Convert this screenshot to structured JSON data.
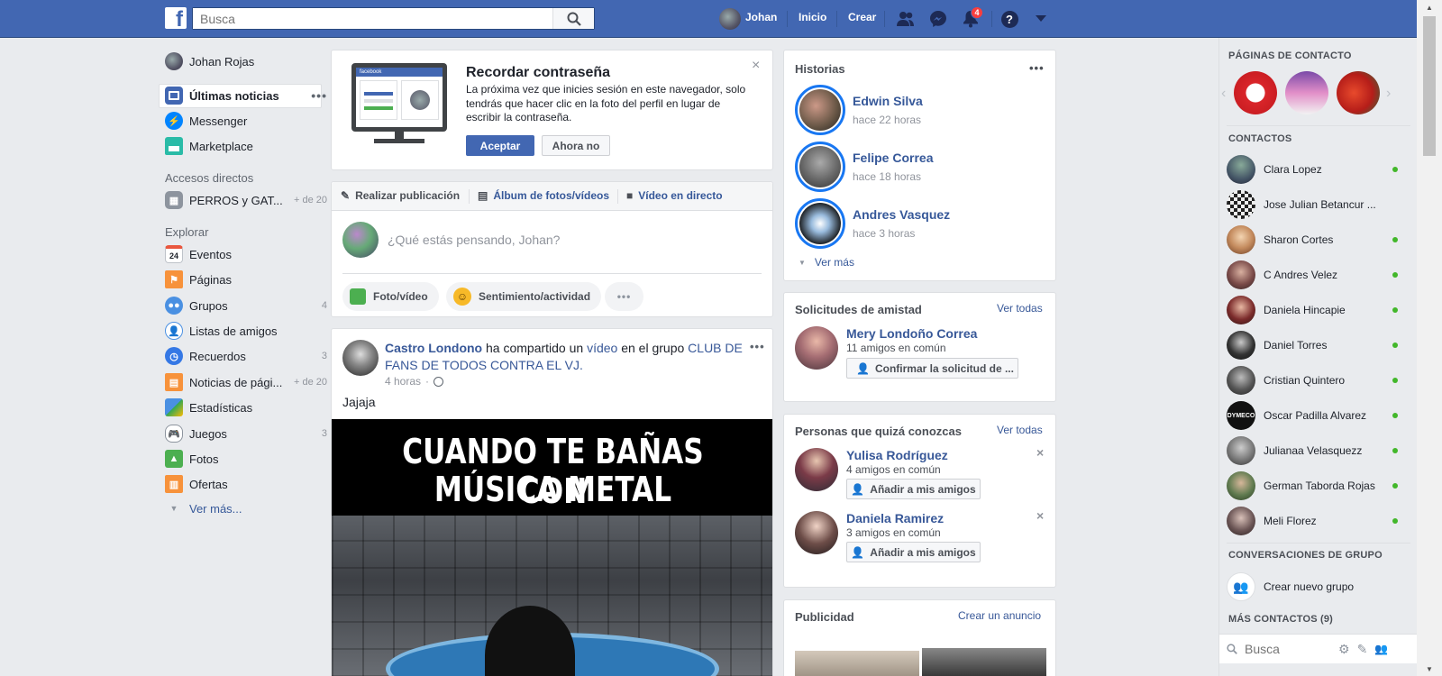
{
  "topbar": {
    "logo": "f",
    "search_placeholder": "Busca",
    "user_name": "Johan",
    "home": "Inicio",
    "create": "Crear",
    "notif_count": "4"
  },
  "left": {
    "profile_name": "Johan Rojas",
    "main_items": [
      {
        "label": "Últimas noticias"
      },
      {
        "label": "Messenger"
      },
      {
        "label": "Marketplace"
      }
    ],
    "shortcuts_title": "Accesos directos",
    "shortcuts": [
      {
        "label": "PERROS y GAT...",
        "count": "+ de 20"
      }
    ],
    "explore_title": "Explorar",
    "explore": [
      {
        "label": "Eventos",
        "count": "",
        "icon": "calendar-icon"
      },
      {
        "label": "Páginas",
        "count": "",
        "icon": "flag-icon"
      },
      {
        "label": "Grupos",
        "count": "4",
        "icon": "groups-icon"
      },
      {
        "label": "Listas de amigos",
        "count": "",
        "icon": "friends-list-icon"
      },
      {
        "label": "Recuerdos",
        "count": "3",
        "icon": "memories-icon"
      },
      {
        "label": "Noticias de pági...",
        "count": "+ de 20",
        "icon": "pages-feed-icon"
      },
      {
        "label": "Estadísticas",
        "count": "",
        "icon": "stats-icon"
      },
      {
        "label": "Juegos",
        "count": "3",
        "icon": "games-icon"
      },
      {
        "label": "Fotos",
        "count": "",
        "icon": "photos-icon"
      },
      {
        "label": "Ofertas",
        "count": "",
        "icon": "offers-icon"
      }
    ],
    "see_more": "Ver más..."
  },
  "password_card": {
    "title": "Recordar contraseña",
    "body": "La próxima vez que inicies sesión en este navegador, solo tendrás que hacer clic en la foto del perfil en lugar de escribir la contraseña.",
    "accept": "Aceptar",
    "decline": "Ahora no",
    "monitor_brand": "facebook"
  },
  "composer": {
    "tabs": [
      "Realizar publicación",
      "Álbum de fotos/vídeos",
      "Vídeo en directo"
    ],
    "placeholder": "¿Qué estás pensando, Johan?",
    "actions": [
      "Foto/vídeo",
      "Sentimiento/actividad"
    ]
  },
  "post": {
    "author": "Castro Londono",
    "action_mid": " ha compartido un ",
    "action_link": "vídeo",
    "action_mid2": " en el grupo ",
    "group": "CLUB DE FANS DE TODOS CONTRA EL VJ.",
    "time": "4 horas",
    "text": "Jajaja",
    "meme_line1": "CUANDO TE BAÑAS CON",
    "meme_line2": "MÚSICA METAL"
  },
  "stories": {
    "title": "Historias",
    "items": [
      {
        "name": "Edwin Silva",
        "time": "hace 22 horas"
      },
      {
        "name": "Felipe Correa",
        "time": "hace 18 horas"
      },
      {
        "name": "Andres Vasquez",
        "time": "hace 3 horas"
      }
    ],
    "see_more": "Ver más"
  },
  "requests": {
    "title": "Solicitudes de amistad",
    "see_all": "Ver todas",
    "name": "Mery Londoño Correa",
    "mutual": "11 amigos en común",
    "confirm": "Confirmar la solicitud de ..."
  },
  "pymk": {
    "title": "Personas que quizá conozcas",
    "see_all": "Ver todas",
    "items": [
      {
        "name": "Yulisa Rodríguez",
        "mutual": "4 amigos en común",
        "add": "Añadir a mis amigos"
      },
      {
        "name": "Daniela Ramirez",
        "mutual": "3 amigos en común",
        "add": "Añadir a mis amigos"
      }
    ]
  },
  "ads": {
    "title": "Publicidad",
    "create": "Crear un anuncio"
  },
  "sidebar": {
    "pages_title": "PÁGINAS DE CONTACTO",
    "contacts_title": "CONTACTOS",
    "contacts": [
      "Clara Lopez",
      "Jose Julian Betancur ...",
      "Sharon Cortes",
      "C Andres Velez",
      "Daniela Hincapie",
      "Daniel Torres",
      "Cristian Quintero",
      "Oscar Padilla Alvarez",
      "Julianaa Velasquezz",
      "German Taborda Rojas",
      "Meli Florez"
    ],
    "group_conv_title": "CONVERSACIONES DE GRUPO",
    "new_group": "Crear nuevo grupo",
    "more_contacts": "MÁS CONTACTOS (9)",
    "search_placeholder": "Busca"
  },
  "colors": {
    "brand": "#4267b2",
    "link": "#365899",
    "online": "#42b72a",
    "badge": "#fa3e3e"
  }
}
